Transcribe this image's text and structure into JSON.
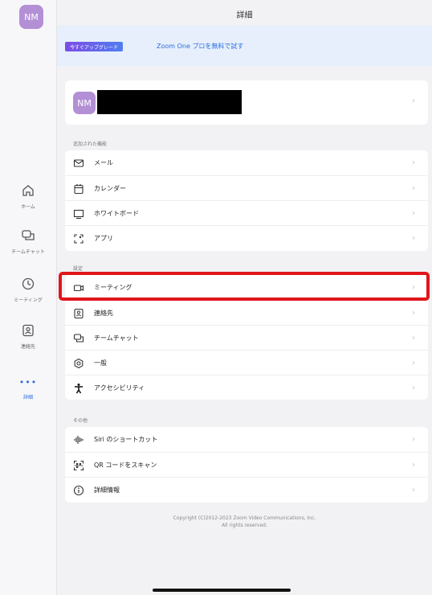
{
  "sidebar": {
    "avatar_initials": "NM",
    "items": [
      {
        "label": "ホーム",
        "icon": "home-icon"
      },
      {
        "label": "チームチャット",
        "icon": "chat-icon"
      },
      {
        "label": "ミーティング",
        "icon": "clock-icon"
      },
      {
        "label": "連絡先",
        "icon": "contacts-icon"
      },
      {
        "label": "詳細",
        "icon": "more-dots-icon",
        "dots": "•••"
      }
    ]
  },
  "header": {
    "title": "詳細"
  },
  "banner": {
    "upgrade_label": "今すぐアップグレード",
    "promo_text": "Zoom One プロを無料で試す"
  },
  "profile": {
    "initials": "NM"
  },
  "sections": {
    "added_header": "追加された機能",
    "added_items": [
      {
        "label": "メール",
        "icon": "mail-icon"
      },
      {
        "label": "カレンダー",
        "icon": "calendar-icon"
      },
      {
        "label": "ホワイトボード",
        "icon": "whiteboard-icon"
      },
      {
        "label": "アプリ",
        "icon": "apps-icon"
      }
    ],
    "settings_header": "設定",
    "settings_items": [
      {
        "label": "ミーティング",
        "icon": "video-camera-icon"
      },
      {
        "label": "連絡先",
        "icon": "contacts-icon"
      },
      {
        "label": "チームチャット",
        "icon": "chat-icon"
      },
      {
        "label": "一般",
        "icon": "gear-icon"
      },
      {
        "label": "アクセシビリティ",
        "icon": "accessibility-icon"
      }
    ],
    "other_header": "その他",
    "other_items": [
      {
        "label": "Siri のショートカット",
        "icon": "siri-wave-icon"
      },
      {
        "label": "QR コードをスキャン",
        "icon": "qr-scan-icon"
      },
      {
        "label": "詳細情報",
        "icon": "info-icon"
      }
    ]
  },
  "footer": {
    "copyright_line1": "Copyright (C)2012-2023 Zoom Video Communications, Inc.",
    "copyright_line2": "All rights reserved."
  },
  "colors": {
    "accent": "#2d6de0",
    "highlight": "#e0161b",
    "avatar": "#b38fd6"
  }
}
